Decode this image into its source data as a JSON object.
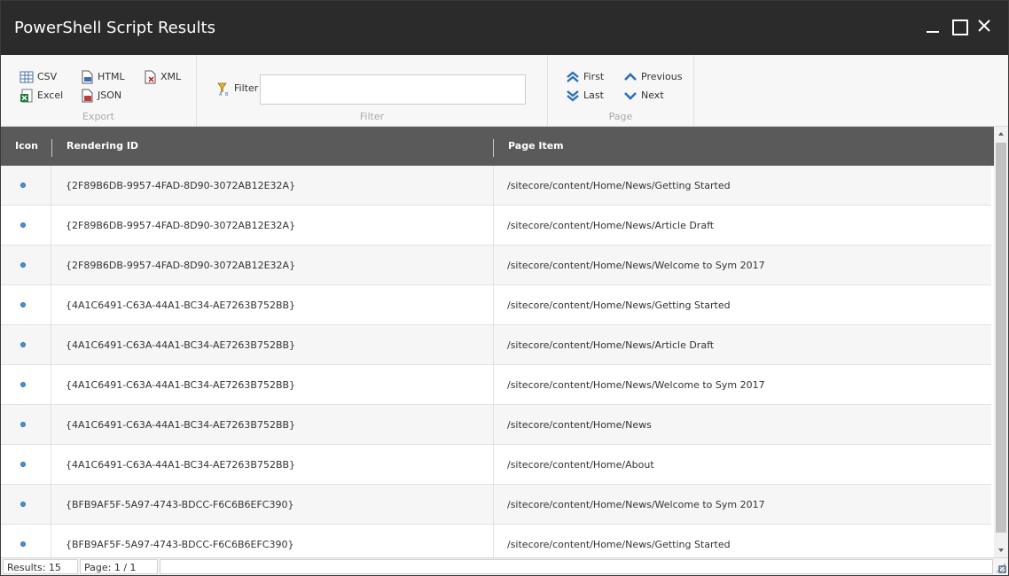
{
  "window": {
    "title": "PowerShell Script Results"
  },
  "ribbon": {
    "export": {
      "label": "Export",
      "csv": "CSV",
      "excel": "Excel",
      "html": "HTML",
      "json": "JSON",
      "xml": "XML"
    },
    "filter": {
      "label": "Filter",
      "button": "Filter",
      "value": "",
      "placeholder": ""
    },
    "page": {
      "label": "Page",
      "first": "First",
      "last": "Last",
      "previous": "Previous",
      "next": "Next"
    }
  },
  "grid": {
    "columns": {
      "icon": "Icon",
      "rendering_id": "Rendering ID",
      "page_item": "Page Item"
    },
    "rows": [
      {
        "rendering_id": "{2F89B6DB-9957-4FAD-8D90-3072AB12E32A}",
        "page_item": "/sitecore/content/Home/News/Getting Started"
      },
      {
        "rendering_id": "{2F89B6DB-9957-4FAD-8D90-3072AB12E32A}",
        "page_item": "/sitecore/content/Home/News/Article Draft"
      },
      {
        "rendering_id": "{2F89B6DB-9957-4FAD-8D90-3072AB12E32A}",
        "page_item": "/sitecore/content/Home/News/Welcome to Sym 2017"
      },
      {
        "rendering_id": "{4A1C6491-C63A-44A1-BC34-AE7263B752BB}",
        "page_item": "/sitecore/content/Home/News/Getting Started"
      },
      {
        "rendering_id": "{4A1C6491-C63A-44A1-BC34-AE7263B752BB}",
        "page_item": "/sitecore/content/Home/News/Article Draft"
      },
      {
        "rendering_id": "{4A1C6491-C63A-44A1-BC34-AE7263B752BB}",
        "page_item": "/sitecore/content/Home/News/Welcome to Sym 2017"
      },
      {
        "rendering_id": "{4A1C6491-C63A-44A1-BC34-AE7263B752BB}",
        "page_item": "/sitecore/content/Home/News"
      },
      {
        "rendering_id": "{4A1C6491-C63A-44A1-BC34-AE7263B752BB}",
        "page_item": "/sitecore/content/Home/About"
      },
      {
        "rendering_id": "{BFB9AF5F-5A97-4743-BDCC-F6C6B6EFC390}",
        "page_item": "/sitecore/content/Home/News/Welcome to Sym 2017"
      },
      {
        "rendering_id": "{BFB9AF5F-5A97-4743-BDCC-F6C6B6EFC390}",
        "page_item": "/sitecore/content/Home/News/Getting Started"
      }
    ]
  },
  "status": {
    "results": "Results: 15",
    "page": "Page: 1 / 1"
  },
  "colors": {
    "titlebar": "#2b2b2b",
    "header": "#5a5a5a",
    "accent": "#2d6fb8"
  }
}
